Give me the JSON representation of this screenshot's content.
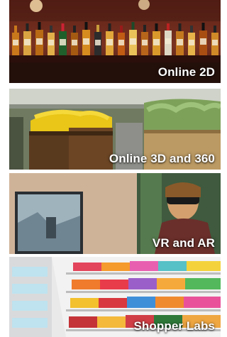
{
  "tiles": [
    {
      "label": "Online 2D",
      "icon": "liquor-shelf-photo"
    },
    {
      "label": "Online 3D and 360",
      "icon": "produce-aisle-photo"
    },
    {
      "label": "VR and AR",
      "icon": "vr-headset-photo"
    },
    {
      "label": "Shopper Labs",
      "icon": "store-shelves-photo"
    }
  ],
  "colors": {
    "label_text": "#ffffff",
    "background": "#ffffff"
  }
}
